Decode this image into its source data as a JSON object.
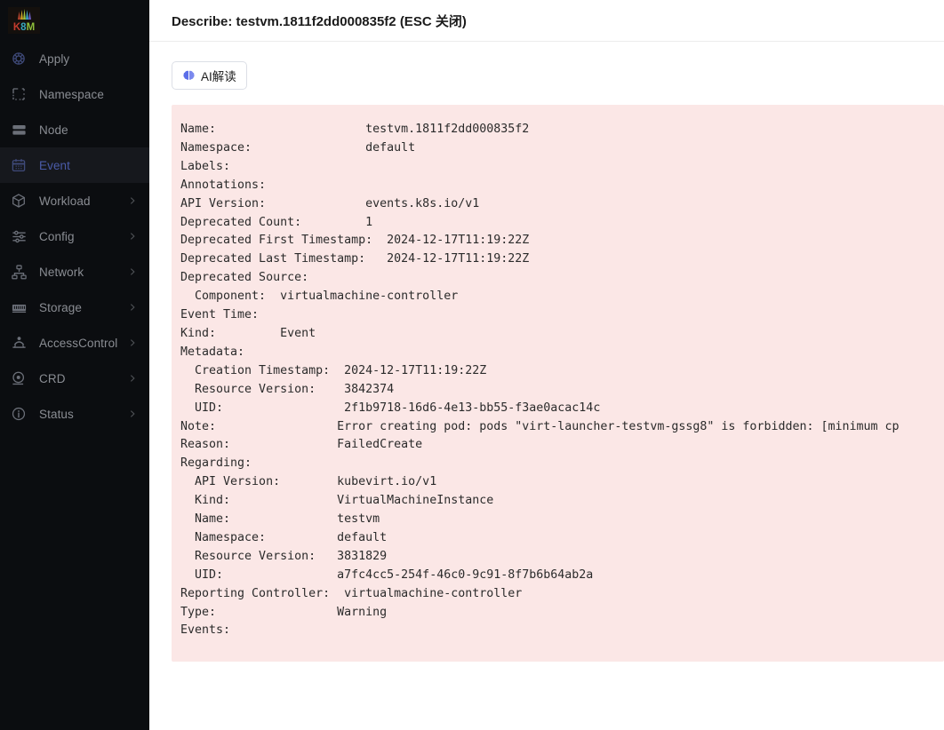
{
  "brand": {
    "logo_text": "K8M"
  },
  "sidebar": {
    "items": [
      {
        "label": "Apply",
        "icon": "helm-wheel-icon",
        "expandable": false,
        "active": false
      },
      {
        "label": "Namespace",
        "icon": "dashed-square-icon",
        "expandable": false,
        "active": false
      },
      {
        "label": "Node",
        "icon": "server-stack-icon",
        "expandable": false,
        "active": false
      },
      {
        "label": "Event",
        "icon": "calendar-icon",
        "expandable": false,
        "active": true
      },
      {
        "label": "Workload",
        "icon": "cube-icon",
        "expandable": true,
        "active": false
      },
      {
        "label": "Config",
        "icon": "sliders-icon",
        "expandable": true,
        "active": false
      },
      {
        "label": "Network",
        "icon": "network-topology-icon",
        "expandable": true,
        "active": false
      },
      {
        "label": "Storage",
        "icon": "storage-chip-icon",
        "expandable": true,
        "active": false
      },
      {
        "label": "AccessControl",
        "icon": "user-shield-icon",
        "expandable": true,
        "active": false
      },
      {
        "label": "CRD",
        "icon": "disc-icon",
        "expandable": true,
        "active": false
      },
      {
        "label": "Status",
        "icon": "info-circle-icon",
        "expandable": true,
        "active": false
      }
    ]
  },
  "header": {
    "title": "Describe: testvm.1811f2dd000835f2 (ESC 关闭)"
  },
  "toolbar": {
    "ai_button_label": "AI解读",
    "ai_button_icon": "brain-icon"
  },
  "describe": {
    "text": "Name:                     testvm.1811f2dd000835f2\nNamespace:                default\nLabels:\nAnnotations:\nAPI Version:              events.k8s.io/v1\nDeprecated Count:         1\nDeprecated First Timestamp:  2024-12-17T11:19:22Z\nDeprecated Last Timestamp:   2024-12-17T11:19:22Z\nDeprecated Source:\n  Component:  virtualmachine-controller\nEvent Time:\nKind:         Event\nMetadata:\n  Creation Timestamp:  2024-12-17T11:19:22Z\n  Resource Version:    3842374\n  UID:                 2f1b9718-16d6-4e13-bb55-f3ae0acac14c\nNote:                 Error creating pod: pods \"virt-launcher-testvm-gssg8\" is forbidden: [minimum cp\nReason:               FailedCreate\nRegarding:\n  API Version:        kubevirt.io/v1\n  Kind:               VirtualMachineInstance\n  Name:               testvm\n  Namespace:          default\n  Resource Version:   3831829\n  UID:                a7fc4cc5-254f-46c0-9c91-8f7b6b64ab2a\nReporting Controller:  virtualmachine-controller\nType:                 Warning\nEvents:"
  },
  "colors": {
    "sidebar_bg": "#0b0d10",
    "sidebar_active_bg": "#16181d",
    "sidebar_active_text": "#4a5ba8",
    "sidebar_text": "#8a8d93",
    "describe_bg": "#fbe7e6",
    "describe_text": "#2b2b2b",
    "accent_blue": "#4a5ba8",
    "brain_icon_color": "#5b6ee8"
  }
}
